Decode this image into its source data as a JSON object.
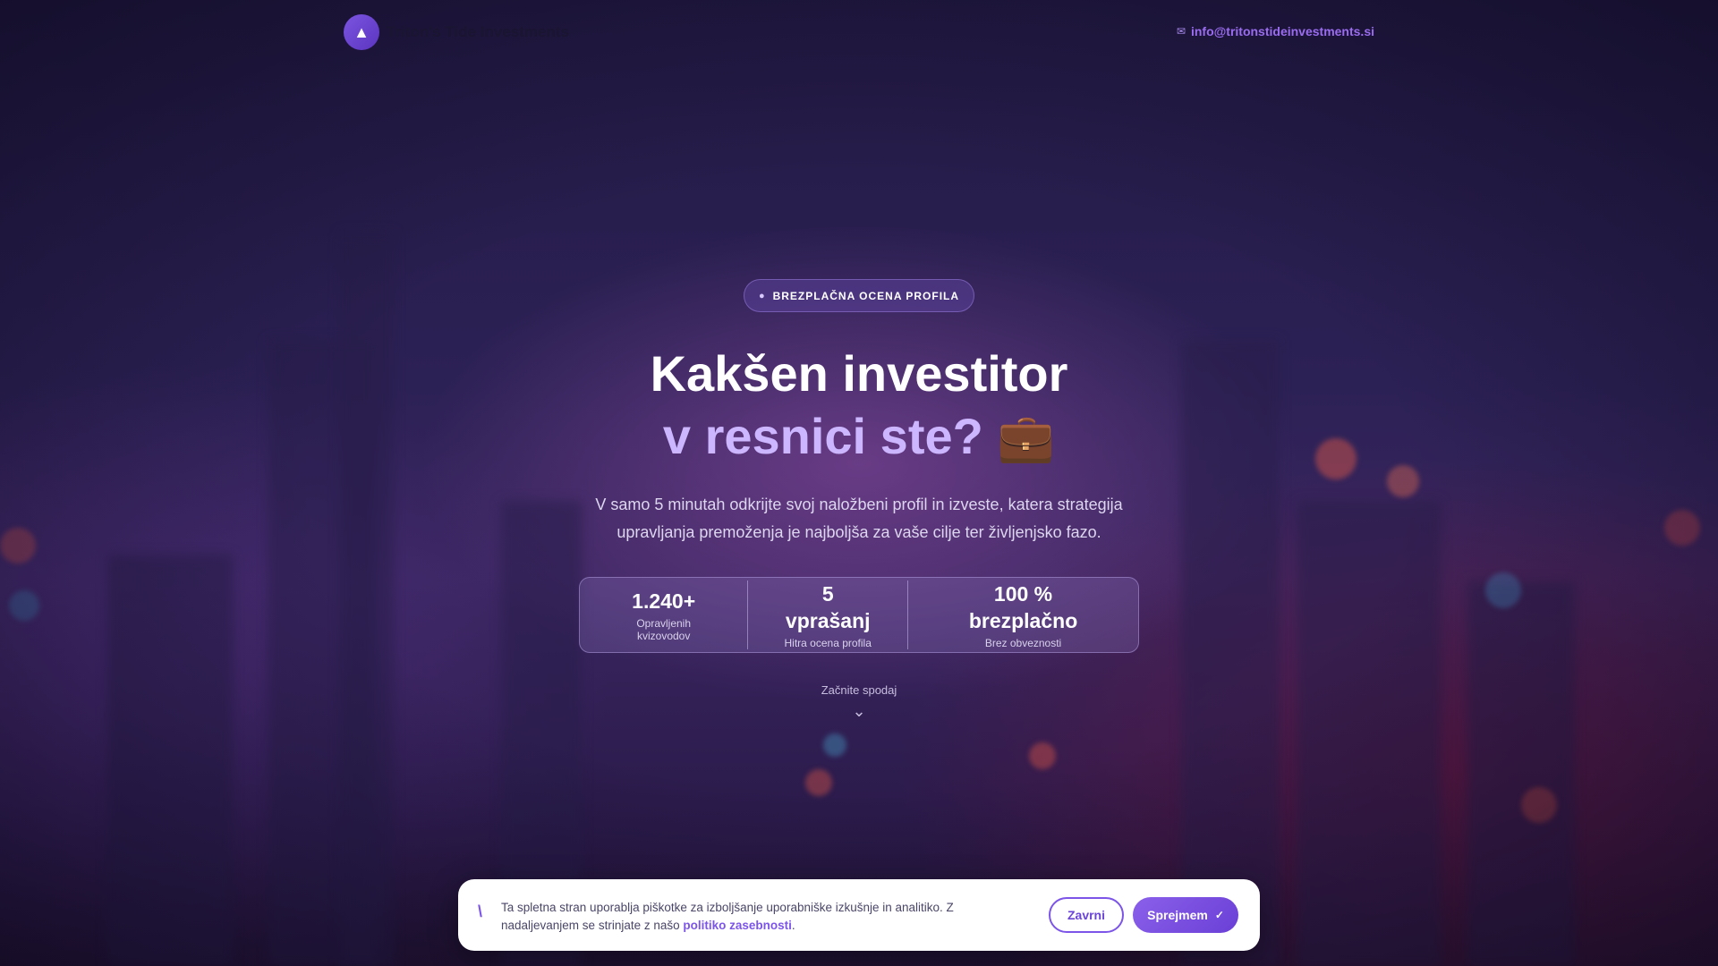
{
  "header": {
    "brand": "Triton's Tide Investments",
    "logo_icon": "chart-icon",
    "email": "info@tritonstideinvestments.si",
    "email_icon": "mail-icon"
  },
  "hero": {
    "badge_label": "BREZPLAČNA OCENA PROFILA",
    "title_line1": "Kakšen investitor",
    "title_line2": "v resnici ste?",
    "title_emoji": "💼",
    "subtitle": "V samo 5 minutah odkrijte svoj naložbeni profil in izveste, katera strategija upravljanja premoženja je najboljša za vaše cilje ter življenjsko fazo.",
    "stats": [
      {
        "value": "1.240+",
        "label": "Opravljenih kvizovodov"
      },
      {
        "value": "5 vprašanj",
        "label": "Hitra ocena profila"
      },
      {
        "value": "100 % brezplačno",
        "label": "Brez obveznosti"
      }
    ],
    "cta_hint": "Začnite spodaj"
  },
  "cookie": {
    "text": "Ta spletna stran uporablja piškotke za izboljšanje uporabniške izkušnje in analitiko. Z nadaljevanjem se strinjate z našo",
    "link_label": "politiko zasebnosti",
    "suffix": ".",
    "decline_label": "Zavrni",
    "accept_label": "Sprejmem"
  },
  "colors": {
    "accent": "#7c55e8",
    "accent_light": "#cbb6ff",
    "background": "#2c2155"
  }
}
